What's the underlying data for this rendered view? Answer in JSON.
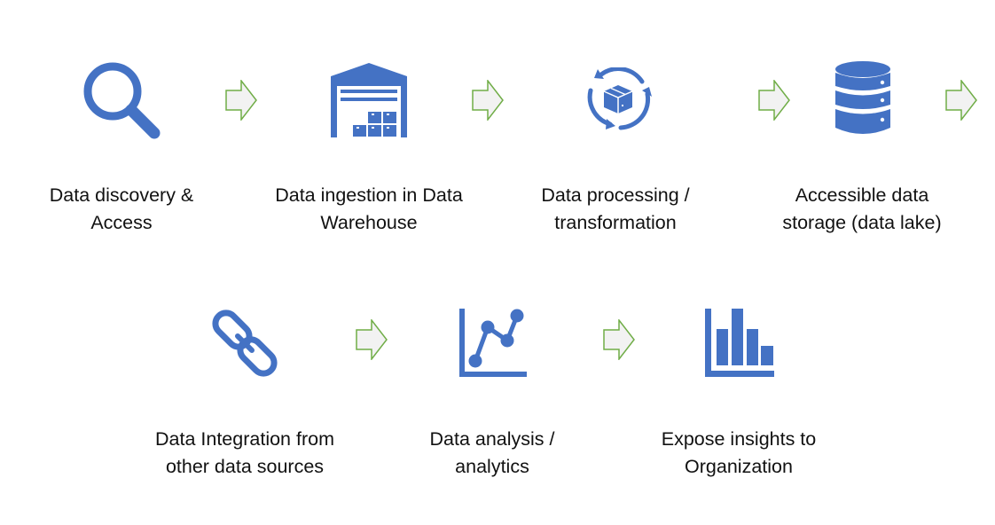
{
  "diagram": {
    "type": "process-flow",
    "colors": {
      "icon_fill": "#4472C4",
      "arrow_fill": "#F2F2F2",
      "arrow_stroke": "#70AD47",
      "text": "#111111",
      "background": "#FFFFFF"
    },
    "rows": [
      {
        "steps": [
          {
            "id": "discovery",
            "icon": "magnifier-icon",
            "label_lines": [
              "Data discovery &",
              "Access"
            ]
          },
          {
            "id": "ingestion",
            "icon": "warehouse-icon",
            "label_lines": [
              "Data ingestion in Data",
              "Warehouse"
            ]
          },
          {
            "id": "processing",
            "icon": "box-cycle-icon",
            "label_lines": [
              "Data processing /",
              "transformation"
            ]
          },
          {
            "id": "storage",
            "icon": "database-icon",
            "label_lines": [
              "Accessible data",
              "storage (data lake)"
            ]
          }
        ],
        "arrows": [
          "right-arrow",
          "right-arrow",
          "right-arrow",
          "right-arrow"
        ]
      },
      {
        "steps": [
          {
            "id": "integration",
            "icon": "chain-link-icon",
            "label_lines": [
              "Data Integration from",
              "other data sources"
            ]
          },
          {
            "id": "analysis",
            "icon": "line-chart-icon",
            "label_lines": [
              "Data analysis /",
              "analytics"
            ]
          },
          {
            "id": "insights",
            "icon": "bar-chart-icon",
            "label_lines": [
              "Expose insights to",
              "Organization"
            ]
          }
        ],
        "arrows": [
          "right-arrow",
          "right-arrow"
        ]
      }
    ]
  }
}
